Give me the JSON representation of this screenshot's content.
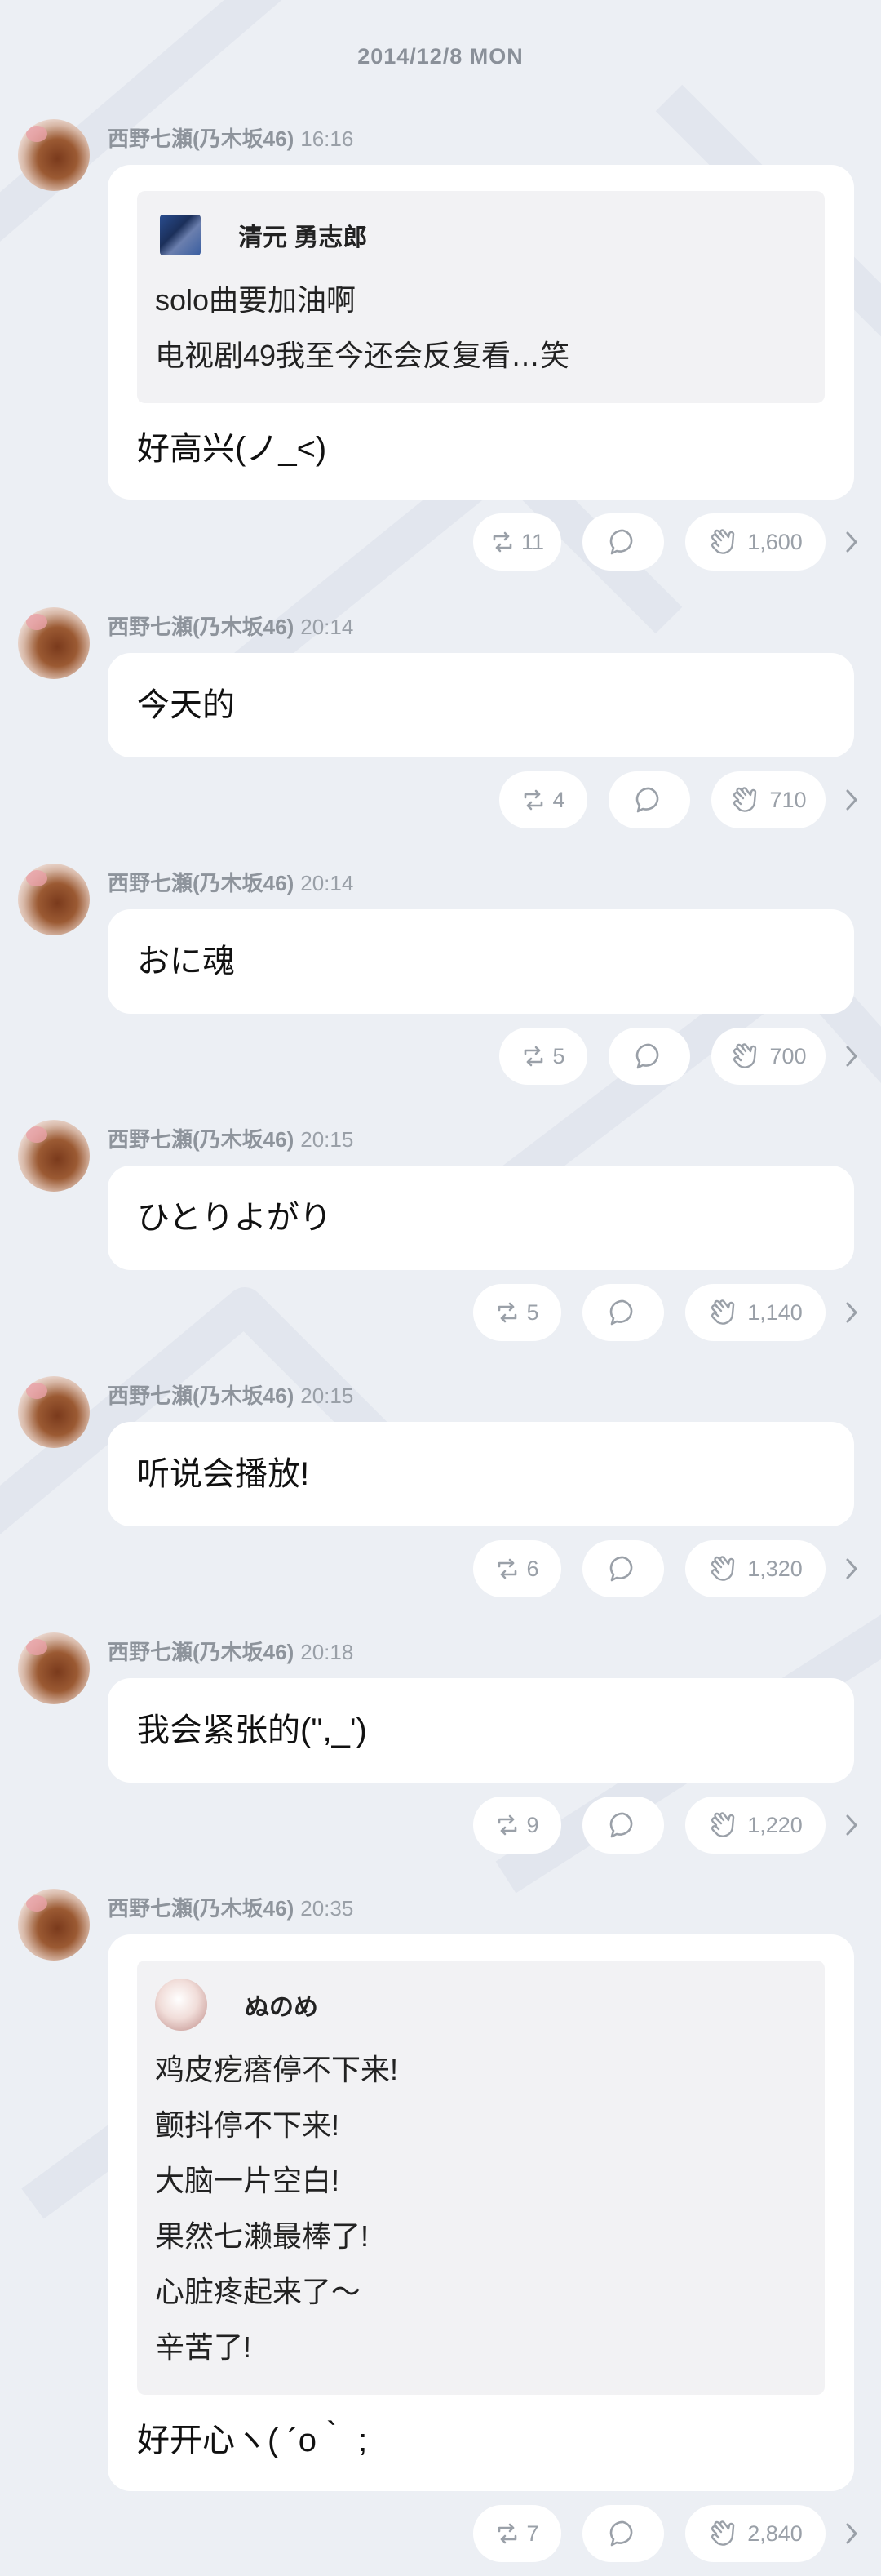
{
  "date_header": "2014/12/8 MON",
  "author_name": "西野七瀬(乃木坂46)",
  "posts": [
    {
      "time": "16:16",
      "reply": {
        "name": "清元 勇志郎",
        "avatar": "square-photo",
        "lines": [
          "solo曲要加油啊",
          "电视剧49我至今还会反复看…笑"
        ]
      },
      "text": "好高兴(ノ_<)",
      "retweets": "11",
      "claps": "1,600"
    },
    {
      "time": "20:14",
      "text": "今天的",
      "retweets": "4",
      "claps": "710"
    },
    {
      "time": "20:14",
      "text": "おに魂",
      "retweets": "5",
      "claps": "700"
    },
    {
      "time": "20:15",
      "text": "ひとりよがり",
      "retweets": "5",
      "claps": "1,140"
    },
    {
      "time": "20:15",
      "text": "听说会播放!",
      "retweets": "6",
      "claps": "1,320"
    },
    {
      "time": "20:18",
      "text": "我会紧张的(\",_')",
      "retweets": "9",
      "claps": "1,220"
    },
    {
      "time": "20:35",
      "reply": {
        "name": "ぬのめ",
        "avatar": "round-photo",
        "lines": [
          "鸡皮疙瘩停不下来!",
          "颤抖停不下来!",
          "大脑一片空白!",
          "果然七濑最棒了!",
          "心脏疼起来了〜",
          "辛苦了!"
        ]
      },
      "text": "好开心ヽ( ´o｀ ;",
      "retweets": "7",
      "claps": "2,840"
    }
  ],
  "icons": {
    "retweet": "retweet-icon",
    "comment": "comment-icon",
    "clap": "clap-icon",
    "chevron": "chevron-right-icon"
  },
  "colors": {
    "background": "#eceff4",
    "bubble": "#ffffff",
    "reply_box": "#f2f2f4",
    "muted_text": "#9aa0a8"
  }
}
